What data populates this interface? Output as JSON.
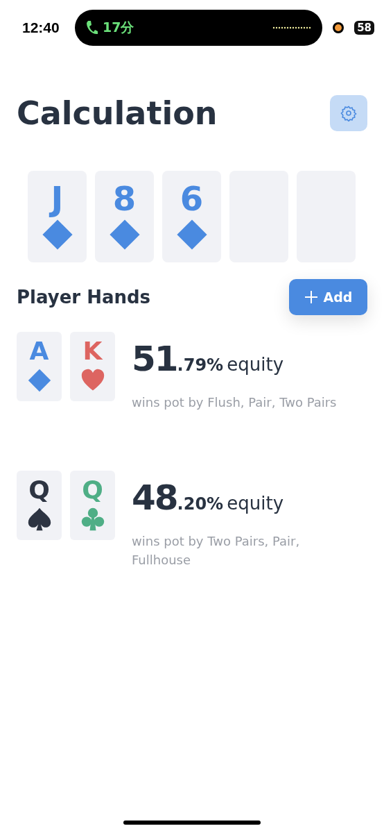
{
  "status_bar": {
    "time": "12:40",
    "call_duration": "17分",
    "battery": "58"
  },
  "header": {
    "title": "Calculation"
  },
  "board": [
    {
      "rank": "J",
      "kind": "diamonds"
    },
    {
      "rank": "8",
      "kind": "diamonds"
    },
    {
      "rank": "6",
      "kind": "diamonds"
    },
    {
      "kind": "empty"
    },
    {
      "kind": "empty"
    }
  ],
  "players_section": {
    "title": "Player Hands",
    "add_button": "Add"
  },
  "players": [
    {
      "cards": [
        {
          "rank": "A",
          "kind": "diamonds"
        },
        {
          "rank": "K",
          "kind": "hearts"
        }
      ],
      "equity_whole": "51",
      "equity_fraction": ".79%",
      "equity_label": "equity",
      "wins": "wins pot by Flush, Pair, Two Pairs"
    },
    {
      "cards": [
        {
          "rank": "Q",
          "kind": "spades"
        },
        {
          "rank": "Q",
          "kind": "clubs"
        }
      ],
      "equity_whole": "48",
      "equity_fraction": ".20%",
      "equity_label": "equity",
      "wins": "wins pot by Two Pairs, Pair, Fullhouse"
    }
  ]
}
